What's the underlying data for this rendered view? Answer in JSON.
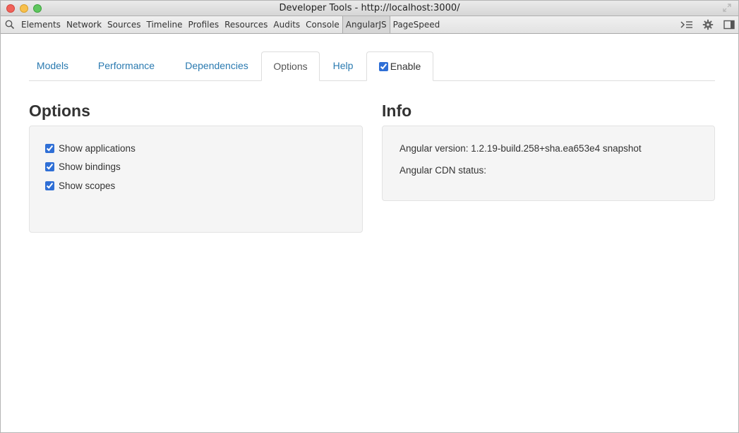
{
  "window": {
    "title": "Developer Tools - http://localhost:3000/"
  },
  "devtools_toolbar": {
    "search_icon": "search-icon",
    "tabs": [
      {
        "label": "Elements",
        "active": false
      },
      {
        "label": "Network",
        "active": false
      },
      {
        "label": "Sources",
        "active": false
      },
      {
        "label": "Timeline",
        "active": false
      },
      {
        "label": "Profiles",
        "active": false
      },
      {
        "label": "Resources",
        "active": false
      },
      {
        "label": "Audits",
        "active": false
      },
      {
        "label": "Console",
        "active": false
      },
      {
        "label": "AngularJS",
        "active": true
      },
      {
        "label": "PageSpeed",
        "active": false
      }
    ],
    "right_icons": [
      "console-drawer-icon",
      "gear-icon",
      "dock-icon"
    ]
  },
  "panel_tabs": {
    "models": "Models",
    "performance": "Performance",
    "dependencies": "Dependencies",
    "options": "Options",
    "help": "Help",
    "enable": "Enable",
    "enable_checked": true,
    "active": "Options"
  },
  "options": {
    "heading": "Options",
    "items": [
      {
        "label": "Show applications",
        "checked": true
      },
      {
        "label": "Show bindings",
        "checked": true
      },
      {
        "label": "Show scopes",
        "checked": true
      }
    ]
  },
  "info": {
    "heading": "Info",
    "angular_version": "Angular version: 1.2.19-build.258+sha.ea653e4 snapshot",
    "cdn_status": "Angular CDN status:"
  },
  "colors": {
    "link": "#2a7ab0",
    "well_bg": "#f5f5f5",
    "checkbox": "#2f6fd6"
  }
}
